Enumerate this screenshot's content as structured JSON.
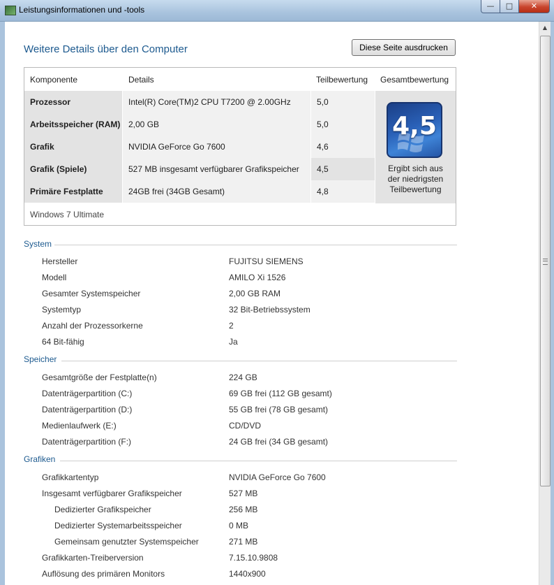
{
  "window": {
    "title": "Leistungsinformationen und -tools",
    "minimize_icon": "minimize-icon",
    "maximize_icon": "maximize-icon",
    "close_icon": "close-icon"
  },
  "page": {
    "title": "Weitere Details über den Computer",
    "print_button": "Diese Seite ausdrucken"
  },
  "rating_table": {
    "headers": {
      "component": "Komponente",
      "details": "Details",
      "subscore": "Teilbewertung",
      "overall": "Gesamtbewertung"
    },
    "rows": [
      {
        "component": "Prozessor",
        "details": "Intel(R) Core(TM)2 CPU T7200 @ 2.00GHz",
        "score": "5,0"
      },
      {
        "component": "Arbeitsspeicher (RAM)",
        "details": "2,00 GB",
        "score": "5,0"
      },
      {
        "component": "Grafik",
        "details": "NVIDIA GeForce Go 7600",
        "score": "4,6"
      },
      {
        "component": "Grafik (Spiele)",
        "details": "527 MB insgesamt verfügbarer Grafikspeicher",
        "score": "4,5"
      },
      {
        "component": "Primäre Festplatte",
        "details": "24GB frei (34GB Gesamt)",
        "score": "4,8"
      }
    ],
    "overall_score": "4,5",
    "overall_note_lines": [
      "Ergibt sich aus",
      "der niedrigsten",
      "Teilbewertung"
    ],
    "os": "Windows 7 Ultimate"
  },
  "sections": [
    {
      "title": "System",
      "items": [
        {
          "label": "Hersteller",
          "value": "FUJITSU SIEMENS"
        },
        {
          "label": "Modell",
          "value": "AMILO Xi 1526"
        },
        {
          "label": "Gesamter Systemspeicher",
          "value": "2,00 GB RAM"
        },
        {
          "label": "Systemtyp",
          "value": "32 Bit-Betriebssystem"
        },
        {
          "label": "Anzahl der Prozessorkerne",
          "value": "2"
        },
        {
          "label": "64 Bit-fähig",
          "value": "Ja"
        }
      ]
    },
    {
      "title": "Speicher",
      "items": [
        {
          "label": "Gesamtgröße der Festplatte(n)",
          "value": "224 GB"
        },
        {
          "label": "Datenträgerpartition (C:)",
          "value": "69 GB frei (112 GB gesamt)"
        },
        {
          "label": "Datenträgerpartition (D:)",
          "value": "55 GB frei (78 GB gesamt)"
        },
        {
          "label": "Medienlaufwerk (E:)",
          "value": "CD/DVD"
        },
        {
          "label": "Datenträgerpartition (F:)",
          "value": "24 GB frei (34 GB gesamt)"
        }
      ]
    },
    {
      "title": "Grafiken",
      "items": [
        {
          "label": "Grafikkartentyp",
          "value": "NVIDIA GeForce Go 7600"
        },
        {
          "label": "Insgesamt verfügbarer Grafikspeicher",
          "value": "527 MB"
        },
        {
          "label": "Dedizierter Grafikspeicher",
          "value": "256 MB"
        },
        {
          "label": "Dedizierter Systemarbeitsspeicher",
          "value": "0 MB"
        },
        {
          "label": "Gemeinsam genutzter Systemspeicher",
          "value": "271 MB"
        },
        {
          "label": "Grafikkarten-Treiberversion",
          "value": "7.15.10.9808"
        },
        {
          "label": "Auflösung des primären Monitors",
          "value": "1440x900"
        }
      ]
    }
  ]
}
